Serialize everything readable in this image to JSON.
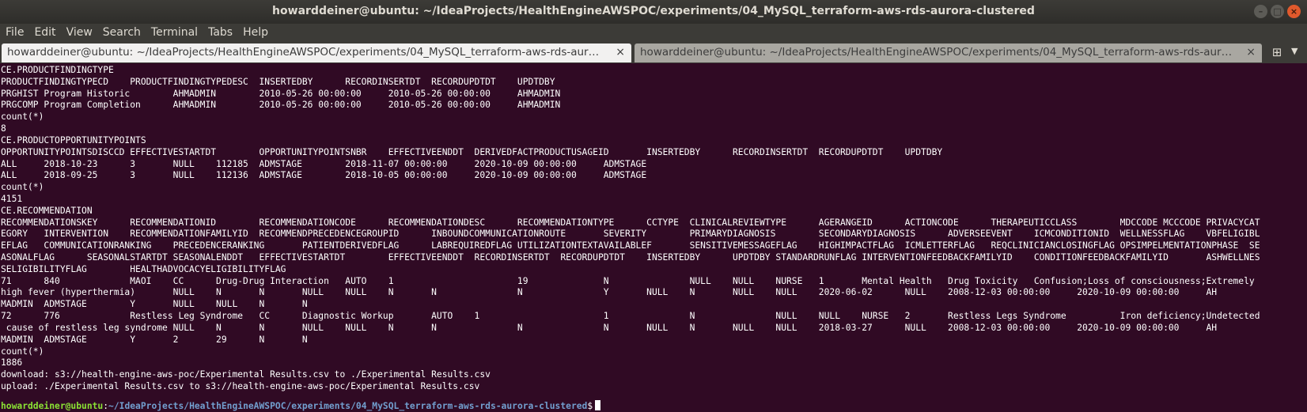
{
  "window": {
    "title": "howarddeiner@ubuntu: ~/IdeaProjects/HealthEngineAWSPOC/experiments/04_MySQL_terraform-aws-rds-aurora-clustered",
    "buttons": {
      "minimize": "–",
      "maximize": "□",
      "close": "×"
    }
  },
  "menu": [
    "File",
    "Edit",
    "View",
    "Search",
    "Terminal",
    "Tabs",
    "Help"
  ],
  "tabs": [
    {
      "label": "howarddeiner@ubuntu: ~/IdeaProjects/HealthEngineAWSPOC/experiments/04_MySQL_terraform-aws-rds-aur…",
      "close": "×"
    },
    {
      "label": "howarddeiner@ubuntu: ~/IdeaProjects/HealthEngineAWSPOC/experiments/04_MySQL_terraform-aws-rds-aur…",
      "close": "×"
    }
  ],
  "tabbar_icons": {
    "new_tab": "⊞",
    "menu": "▼"
  },
  "terminal": {
    "lines": [
      "CE.PRODUCTFINDINGTYPE",
      "PRODUCTFINDINGTYPECD    PRODUCTFINDINGTYPEDESC  INSERTEDBY      RECORDINSERTDT  RECORDUPDTDT    UPDTDBY",
      "PRGHIST Program Historic        AHMADMIN        2010-05-26 00:00:00     2010-05-26 00:00:00     AHMADMIN",
      "PRGCOMP Program Completion      AHMADMIN        2010-05-26 00:00:00     2010-05-26 00:00:00     AHMADMIN",
      "count(*)",
      "8",
      "CE.PRODUCTOPPORTUNITYPOINTS",
      "OPPORTUNITYPOINTSDISCCD EFFECTIVESTARTDT        OPPORTUNITYPOINTSNBR    EFFECTIVEENDDT  DERIVEDFACTPRODUCTUSAGEID       INSERTEDBY      RECORDINSERTDT  RECORDUPDTDT    UPDTDBY",
      "ALL     2018-10-23      3       NULL    112185  ADMSTAGE        2018-11-07 00:00:00     2020-10-09 00:00:00     ADMSTAGE",
      "ALL     2018-09-25      3       NULL    112136  ADMSTAGE        2018-10-05 00:00:00     2020-10-09 00:00:00     ADMSTAGE",
      "count(*)",
      "4151",
      "CE.RECOMMENDATION",
      "RECOMMENDATIONSKEY      RECOMMENDATIONID        RECOMMENDATIONCODE      RECOMMENDATIONDESC      RECOMMENDATIONTYPE      CCTYPE  CLINICALREVIEWTYPE      AGERANGEID      ACTIONCODE      THERAPEUTICCLASS        MDCCODE MCCCODE PRIVACYCAT",
      "EGORY   INTERVENTION    RECOMMENDATIONFAMILYID  RECOMMENDPRECEDENCEGROUPID      INBOUNDCOMMUNICATIONROUTE       SEVERITY        PRIMARYDIAGNOSIS        SECONDARYDIAGNOSIS      ADVERSEEVENT    ICMCONDITIONID  WELLNESSFLAG    VBFELIGIBL",
      "EFLAG   COMMUNICATIONRANKING    PRECEDENCERANKING       PATIENTDERIVEDFLAG      LABREQUIREDFLAG UTILIZATIONTEXTAVAILABLEF       SENSITIVEMESSAGEFLAG    HIGHIMPACTFLAG  ICMLETTERFLAG   REQCLINICIANCLOSINGFLAG OPSIMPELMENTATIONPHASE  SE",
      "ASONALFLAG      SEASONALSTARTDT SEASONALENDDT   EFFECTIVESTARTDT        EFFECTIVEENDDT  RECORDINSERTDT  RECORDUPDTDT    INSERTEDBY      UPDTDBY STANDARDRUNFLAG INTERVENTIONFEEDBACKFAMILYID    CONDITIONFEEDBACKFAMILYID       ASHWELLNES",
      "SELIGIBILITYFLAG        HEALTHADVOCACYELIGIBILITYFLAG",
      "71      840             MAOI    CC      Drug-Drug Interaction   AUTO    1                       19              N               NULL    NULL    NURSE   1       Mental Health   Drug Toxicity   Confusion;Loss of consciousness;Extremely",
      "high fever (hyperthermia)       NULL    N       N       NULL    NULL    N       N               N               Y       NULL    N       NULL    NULL    2020-06-02      NULL    2008-12-03 00:00:00     2020-10-09 00:00:00     AH",
      "MADMIN  ADMSTAGE        Y       NULL    NULL    N       N",
      "72      776             Restless Leg Syndrome   CC      Diagnostic Workup       AUTO    1                       1               N               NULL    NULL    NURSE   2       Restless Legs Syndrome          Iron deficiency;Undetected",
      " cause of restless leg syndrome NULL    N       N       NULL    NULL    N       N               N               N       NULL    N       NULL    NULL    2018-03-27      NULL    2008-12-03 00:00:00     2020-10-09 00:00:00     AH",
      "MADMIN  ADMSTAGE        Y       2       29      N       N",
      "count(*)",
      "1886",
      "download: s3://health-engine-aws-poc/Experimental Results.csv to ./Experimental Results.csv",
      "upload: ./Experimental Results.csv to s3://health-engine-aws-poc/Experimental Results.csv"
    ],
    "prompt": {
      "user": "howarddeiner@ubuntu",
      "separator": ":",
      "path": "~/IdeaProjects/HealthEngineAWSPOC/experiments/04_MySQL_terraform-aws-rds-aurora-clustered",
      "symbol": "$"
    }
  }
}
